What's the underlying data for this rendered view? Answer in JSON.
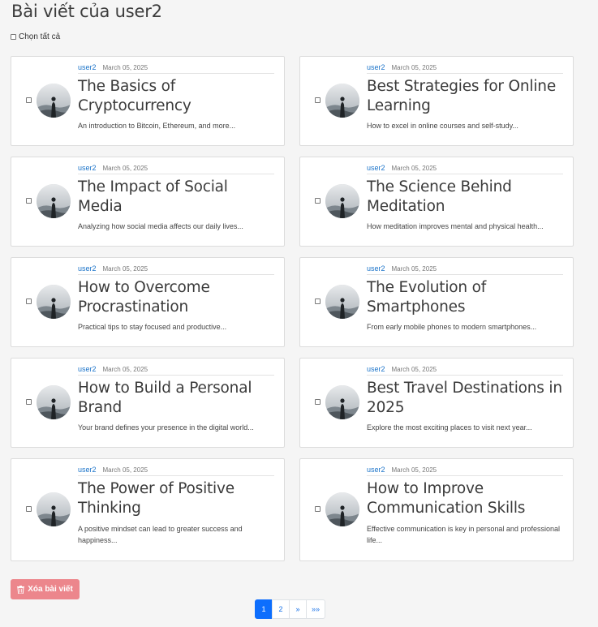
{
  "header": {
    "title": "Bài viết của user2"
  },
  "select_all": {
    "label": "Chọn tất cả"
  },
  "posts": [
    {
      "author": "user2",
      "date": "March 05, 2025",
      "title": "The Basics of Cryptocurrency",
      "excerpt": "An introduction to Bitcoin, Ethereum, and more..."
    },
    {
      "author": "user2",
      "date": "March 05, 2025",
      "title": "Best Strategies for Online Learning",
      "excerpt": "How to excel in online courses and self-study..."
    },
    {
      "author": "user2",
      "date": "March 05, 2025",
      "title": "The Impact of Social Media",
      "excerpt": "Analyzing how social media affects our daily lives..."
    },
    {
      "author": "user2",
      "date": "March 05, 2025",
      "title": "The Science Behind Meditation",
      "excerpt": "How meditation improves mental and physical health..."
    },
    {
      "author": "user2",
      "date": "March 05, 2025",
      "title": "How to Overcome Procrastination",
      "excerpt": "Practical tips to stay focused and productive..."
    },
    {
      "author": "user2",
      "date": "March 05, 2025",
      "title": "The Evolution of Smartphones",
      "excerpt": "From early mobile phones to modern smartphones..."
    },
    {
      "author": "user2",
      "date": "March 05, 2025",
      "title": "How to Build a Personal Brand",
      "excerpt": "Your brand defines your presence in the digital world..."
    },
    {
      "author": "user2",
      "date": "March 05, 2025",
      "title": "Best Travel Destinations in 2025",
      "excerpt": "Explore the most exciting places to visit next year..."
    },
    {
      "author": "user2",
      "date": "March 05, 2025",
      "title": "The Power of Positive Thinking",
      "excerpt": "A positive mindset can lead to greater success and happiness..."
    },
    {
      "author": "user2",
      "date": "March 05, 2025",
      "title": "How to Improve Communication Skills",
      "excerpt": "Effective communication is key in personal and professional life..."
    }
  ],
  "actions": {
    "delete_label": "Xóa bài viết"
  },
  "pagination": {
    "p1": "1",
    "p2": "2",
    "next": "»",
    "last": "»»"
  },
  "colors": {
    "accent": "#0d6efd",
    "link": "#1a73c9",
    "danger": "#ec868c"
  }
}
